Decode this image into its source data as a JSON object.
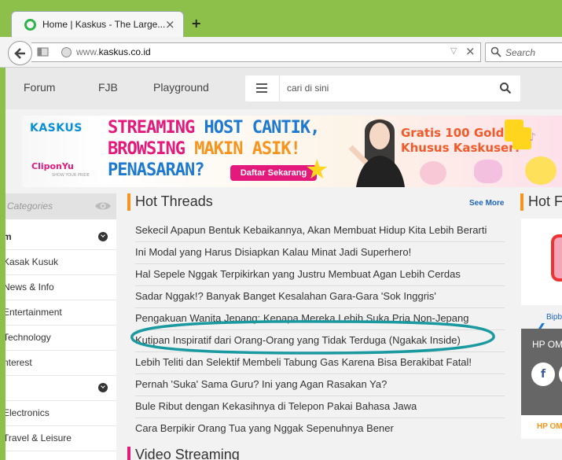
{
  "browser": {
    "tab_title": "Home | Kaskus - The Large...",
    "tab_close": "×",
    "new_tab": "+",
    "url_prefix": "www.",
    "url_domain": "kaskus.co.id",
    "url_clear": "×",
    "search_placeholder": "Search"
  },
  "site_nav": {
    "items": [
      "Forum",
      "FJB",
      "Playground"
    ],
    "search_placeholder": "cari di sini"
  },
  "banner": {
    "logo": "KASKUS",
    "partner": "CliponYu",
    "partner_tagline": "SHOW YOUR PRIDE",
    "line1_a": "STREAMING",
    "line1_b": "HOST CANTIK,",
    "line2_a": "BROWSING",
    "line2_b": "MAKIN ASIK!",
    "line3": "PENASARAN?",
    "cta": "Daftar Sekarang",
    "promo_line1": "Gratis 100 Gold",
    "promo_line2": "Khusus Kaskuser!"
  },
  "sidebar": {
    "title": "Categories",
    "items": [
      {
        "label": "m",
        "bold": true,
        "expand": true
      },
      {
        "label": "Kasak Kusuk"
      },
      {
        "label": "News & Info"
      },
      {
        "label": "Entertainment"
      },
      {
        "label": "Technology"
      },
      {
        "label": "nterest"
      },
      {
        "label": "",
        "expand": true
      },
      {
        "label": "Electronics"
      },
      {
        "label": "Travel & Leisure"
      }
    ]
  },
  "hot_threads": {
    "title": "Hot Threads",
    "see_more": "See More",
    "threads": [
      "Sekecil Apapun Bentuk Kebaikannya, Akan Membuat Hidup Kita Lebih Berarti",
      "Ini Modal yang Harus Disiapkan Kalau Minat Jadi Superhero!",
      "Hal Sepele Nggak Terpikirkan yang Justru Membuat Agan Lebih Cerdas",
      "Sadar Nggak!? Banyak Banget Kesalahan Gara-Gara 'Sok Inggris'",
      "Pengakuan Wanita Jepang: Kenapa Mereka Lebih Suka Pria Non-Jepang",
      "Kutipan Inspiratif dari Orang-Orang yang Tidak Terduga (Ngakak Inside)",
      "Lebih Teliti dan Selektif Membeli Tabung Gas Karena Bisa Berakibat Fatal!",
      "Pernah 'Suka' Sama Guru? Ini yang Agan Rasakan Ya?",
      "Bule Ribut dengan Kekasihnya di Telepon Pakai Bahasa Jawa",
      "Cara Berpikir Orang Tua yang Nggak Sepenuhnya Bener"
    ]
  },
  "video": {
    "title": "Video Streaming"
  },
  "right_col": {
    "title": "Hot F",
    "link": "Bipb",
    "card_text": "HP OM",
    "fb": "f",
    "footer": "HP OM"
  },
  "colors": {
    "window_frame": "#8dc04a",
    "accent_orange": "#f7941d",
    "link_blue": "#1e64b4",
    "highlight_circle": "#1a9aa0"
  }
}
